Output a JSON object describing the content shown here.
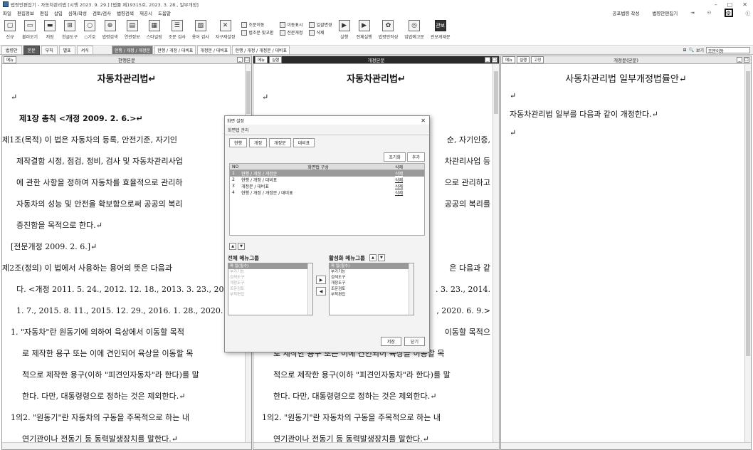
{
  "window": {
    "title": "법령안편집기 - 자동차관리법 [시행 2023. 9. 29.] [법률 제19315호, 2023. 3. 28., 일부개정]",
    "minimize": "–",
    "maximize": "□",
    "close": "✕"
  },
  "menu": {
    "items": [
      "파일",
      "편집정보",
      "편집",
      "삽입",
      "심해/작성",
      "검토/검사",
      "법령검색",
      "재공시",
      "도움말"
    ],
    "right_items": [
      "공포법령 작성",
      "법령안편집기"
    ]
  },
  "toolbar": {
    "buttons": [
      {
        "label": "신규",
        "icon": "new-doc-icon",
        "glyph": "▢"
      },
      {
        "label": "불러오기",
        "icon": "open-icon",
        "glyph": "▭"
      },
      {
        "label": "저장",
        "icon": "save-icon",
        "glyph": "▬"
      },
      {
        "label": "한글도구",
        "icon": "hangul-tool-icon",
        "glyph": "⊞"
      },
      {
        "label": "○기호",
        "icon": "symbol-icon",
        "glyph": "○"
      },
      {
        "label": "법령검색",
        "icon": "law-search-icon",
        "glyph": "⊕"
      },
      {
        "label": "연관정보",
        "icon": "related-info-icon",
        "glyph": "▤"
      },
      {
        "label": "스타일링",
        "icon": "styling-icon",
        "glyph": "▦"
      },
      {
        "label": "조문 검사",
        "icon": "article-check-icon",
        "glyph": "☰"
      },
      {
        "label": "용어 검사",
        "icon": "term-check-icon",
        "glyph": "▧"
      },
      {
        "label": "자구제설정",
        "icon": "phrase-setting-icon",
        "glyph": "✕"
      }
    ],
    "group1": [
      "조문이동",
      "법조문 맞교환"
    ],
    "group2": [
      "이동표시",
      "전문개정"
    ],
    "group3": [
      "일괄변경",
      "삭제"
    ],
    "buttons2": [
      {
        "label": "실행",
        "icon": "run-icon",
        "glyph": "▶"
      },
      {
        "label": "전체실행",
        "icon": "run-all-icon",
        "glyph": "▶"
      },
      {
        "label": "법령안작성",
        "icon": "law-draft-icon",
        "glyph": "✿"
      },
      {
        "label": "입법예고문",
        "icon": "notice-icon",
        "glyph": "◎"
      },
      {
        "label": "관보게재문",
        "icon": "gazette-icon",
        "glyph": "관보"
      }
    ]
  },
  "tabs": {
    "items": [
      "법령안",
      "본문",
      "부칙",
      "별표",
      "서식"
    ],
    "active": "본문",
    "layouts": [
      "현행 / 개정 / 개정문",
      "현행 / 개정 / 대비표",
      "개정문 / 대비표",
      "현행 / 개정 / 개정문 / 대비표"
    ],
    "search_label": "보기",
    "search_value": "조문이동"
  },
  "panels": {
    "left": {
      "menu": "메뉴",
      "title": "현행본문"
    },
    "middle": {
      "menu": "메뉴",
      "extra": "실행",
      "title": "개정본문"
    },
    "right": {
      "menu": "메뉴",
      "extra": "실행",
      "extra2": "고정",
      "title": "개정문(본문)"
    }
  },
  "left_doc": {
    "title": "자동차관리법↵",
    "lines": [
      "↵",
      "제1장 총칙 <개정 2009. 2. 6.>↵",
      "제1조(목적) 이 법은 자동차의 등록, 안전기준, 자기인",
      "제작결함 시정, 점검, 정비, 검사 및 자동차관리사업",
      "에 관한 사항을 정하여 자동차를 효율적으로 관리하",
      "자동차의 성능 및 안전을 확보함으로써 공공의 복리",
      "증진함을 목적으로 한다.↵",
      "[전문개정 2009. 2. 6.]↵",
      "제2조(정의) 이 법에서 사용하는 용어의 뜻은 다음과",
      "다. <개정 2011. 5. 24., 2012. 12. 18., 2013. 3. 23., 20",
      "1. 7., 2015. 8. 11., 2015. 12. 29., 2016. 1. 28., 2020. 6. 9",
      "1. \"자동차\"란 원동기에 의하여 육상에서 이동할 목적",
      "로 제작한 용구 또는 이에 견인되어 육상을 이동할 목",
      "적으로 제작한 용구(이하 \"피견인자동차\"라 한다)를 말",
      "한다. 다만, 대통령령으로 정하는 것은 제외한다.↵",
      "1의2. \"원동기\"란 자동차의 구동을 주목적으로 하는 내",
      "연기관이나 전동기 등 동력발생장치를 말한다.↵"
    ]
  },
  "middle_doc": {
    "title": "자동차관리법↵",
    "lines": [
      "↵",
      "",
      "순, 자기인증,",
      "차관리사업 등",
      "으로 관리하고",
      "공공의 복리를",
      "",
      "",
      "은 다음과 같",
      ". 3. 23., 2014.",
      ", 2020. 6. 9.>",
      "이동할 목적으",
      "로 제작한 용구 또는 이에 견인되어 육상을 이동할 목",
      "적으로 제작한 용구(이하 \"피견인자동차\"라 한다)를 말",
      "한다. 다만, 대통령령으로 정하는 것은 제외한다.↵",
      "1의2. \"원동기\"란 자동차의 구동을 주목적으로 하는 내",
      "연기관이나 전동기 등 동력발생장치를 말한다.↵"
    ]
  },
  "right_doc": {
    "title": "사동차관리법 일부개정법률안↵",
    "lines": [
      "↵",
      "자동차관리법 일부를 다음과 같이 개정한다.↵",
      "↵"
    ]
  },
  "dialog": {
    "title": "화면 설정",
    "subtitle": "화면탭 관리",
    "tabs": [
      "현행",
      "개정",
      "개정문",
      "대비표"
    ],
    "buttons": [
      "초기화",
      "추가"
    ],
    "columns": [
      "NO",
      "화면탭 구성",
      "삭제"
    ],
    "rows": [
      {
        "no": "1",
        "name": "현행 / 개정 / 개정문",
        "del": "삭제",
        "selected": true
      },
      {
        "no": "2",
        "name": "현행 / 개정 / 대비표",
        "del": "삭제",
        "selected": false
      },
      {
        "no": "3",
        "name": "개정문 / 대비표",
        "del": "삭제",
        "selected": false
      },
      {
        "no": "4",
        "name": "현행 / 개정 / 개정문 / 대비표",
        "del": "삭제",
        "selected": false
      }
    ],
    "all_group_title": "전체 메뉴그룹",
    "active_group_title": "활성화 메뉴그룹",
    "all_items": [
      {
        "label": "파  일(필수)",
        "state": "sel"
      },
      {
        "label": "부가기능",
        "state": "dim"
      },
      {
        "label": "검색도구",
        "state": "dim"
      },
      {
        "label": "개정도구",
        "state": "dim"
      },
      {
        "label": "조문검토",
        "state": "dim"
      },
      {
        "label": "부칙편집",
        "state": "dim"
      }
    ],
    "active_items": [
      {
        "label": "파  일(필수)",
        "state": "sel"
      },
      {
        "label": "부가기능",
        "state": ""
      },
      {
        "label": "검색도구",
        "state": ""
      },
      {
        "label": "개정도구",
        "state": ""
      },
      {
        "label": "조문검토",
        "state": ""
      },
      {
        "label": "부칙편집",
        "state": ""
      }
    ],
    "save": "저장",
    "close_btn": "닫기"
  }
}
